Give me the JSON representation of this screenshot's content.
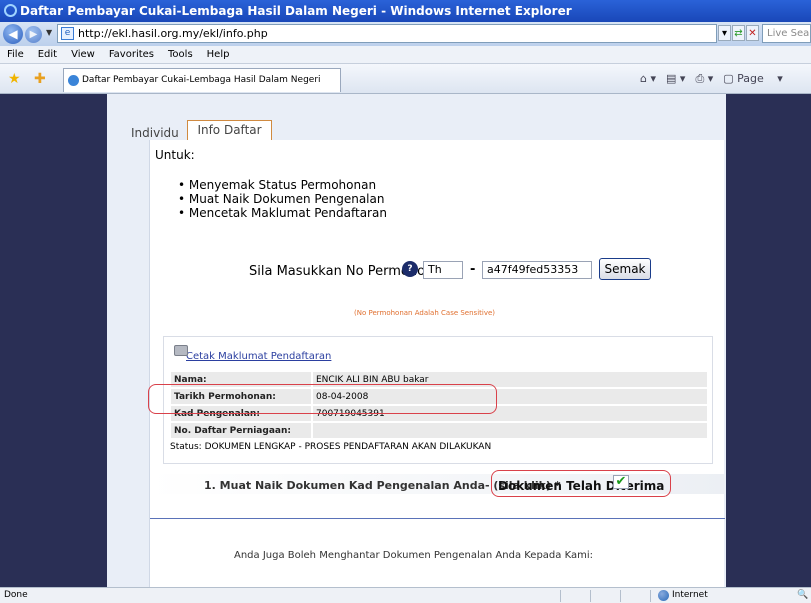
{
  "window": {
    "title": "Daftar Pembayar Cukai-Lembaga Hasil Dalam Negeri - Windows Internet Explorer"
  },
  "address": {
    "url": "http://ekl.hasil.org.my/ekl/info.php",
    "search_placeholder": "Live Search"
  },
  "menu": [
    "File",
    "Edit",
    "View",
    "Favorites",
    "Tools",
    "Help"
  ],
  "browser_tab": {
    "title": "Daftar Pembayar Cukai-Lembaga Hasil Dalam Negeri"
  },
  "command_bar": {
    "page_label": "Page"
  },
  "page_tabs": {
    "individu": "Individu",
    "info_daftar": "Info Daftar"
  },
  "untuk": "Untuk:",
  "bullets": [
    "Menyemak Status Permohonan",
    "Muat Naik Dokumen Pengenalan",
    "Mencetak Maklumat Pendaftaran"
  ],
  "lookup": {
    "label": "Sila Masukkan No Permohonan:",
    "prefix_value": "Th",
    "dash": "-",
    "number_value": "a47f49fed53353",
    "button": "Semak",
    "note": "(No Permohonan Adalah Case Sensitive)"
  },
  "info": {
    "print_link": "Cetak Maklumat Pendaftaran",
    "rows": [
      {
        "label": "Nama:",
        "value": "ENCIK ALI BIN ABU bakar"
      },
      {
        "label": "Tarikh Permohonan:",
        "value": "08-04-2008"
      },
      {
        "label": "Kad Pengenalan:",
        "value": "700719045391"
      },
      {
        "label": "No. Daftar Perniagaan:",
        "value": ""
      }
    ],
    "status": "Status: DOKUMEN LENGKAP - PROSES PENDAFTARAN AKAN DILAKUKAN"
  },
  "upload": {
    "label": "1. Muat Naik Dokumen Kad Pengenalan Anda- (sila klik) *",
    "received": "Dokumen Telah Diterima",
    "check": "✔"
  },
  "footer_text": "Anda Juga Boleh Menghantar Dokumen Pengenalan Anda Kepada Kami:",
  "statusbar": {
    "left": "Done",
    "zone": "Internet"
  },
  "colors": {
    "page_bg": "#2a2f55",
    "accent_orange": "#e07030",
    "highlight_red": "#d9414a",
    "link_blue": "#2b3fa0"
  }
}
